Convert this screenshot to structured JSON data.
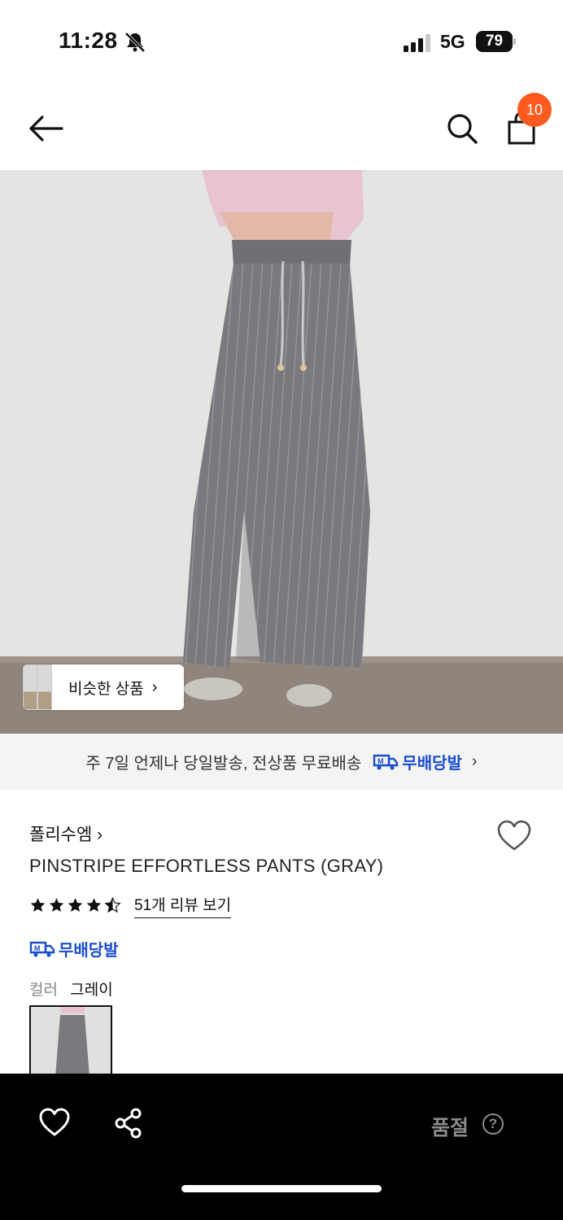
{
  "status_bar": {
    "time": "11:28",
    "network": "5G",
    "battery": "79"
  },
  "header": {
    "cart_count": "10"
  },
  "hero": {
    "similar_label": "비슷한 상품",
    "similar_chevron": "›"
  },
  "delivery": {
    "text": "주 7일 언제나 당일발송, 전상품 무료배송",
    "badge": "무배당발",
    "chevron": "›"
  },
  "product": {
    "brand": "폴리수엠 ›",
    "name": "PINSTRIPE EFFORTLESS PANTS (GRAY)",
    "rating": 4.5,
    "review_link": "51개 리뷰 보기",
    "badge": "무배당발",
    "option_label": "컬러",
    "option_value": "그레이"
  },
  "bottom_bar": {
    "soldout_label": "품절",
    "help_glyph": "?"
  },
  "colors": {
    "accent_badge": "#ff5a1f",
    "brand_blue": "#1b4ecf",
    "bottom_bar": "#000000"
  },
  "icons": [
    "bell-off-icon",
    "signal-icon",
    "back-arrow-icon",
    "search-icon",
    "shopping-bag-icon",
    "delivery-truck-icon",
    "heart-icon",
    "star-icon",
    "share-icon",
    "help-icon"
  ]
}
